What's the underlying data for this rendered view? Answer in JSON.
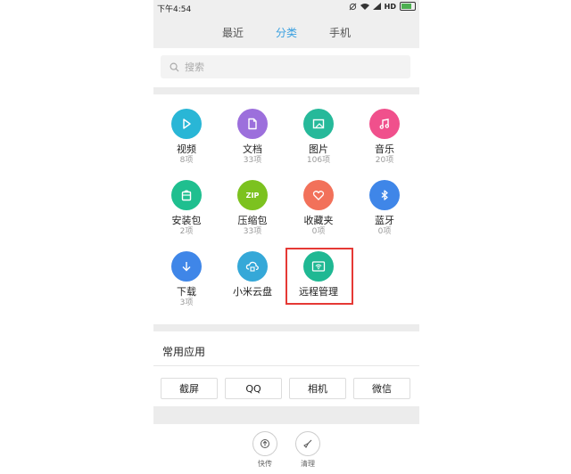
{
  "status_bar": {
    "time": "下午4:54",
    "network": "HD",
    "battery_level": 0.9
  },
  "tabs": [
    {
      "label": "最近"
    },
    {
      "label": "分类",
      "active": true
    },
    {
      "label": "手机"
    }
  ],
  "search": {
    "placeholder": "搜索"
  },
  "categories": [
    {
      "label": "视频",
      "count": "8项",
      "icon": "play-icon",
      "color": "#29b6d6"
    },
    {
      "label": "文档",
      "count": "33项",
      "icon": "document-icon",
      "color": "#9c6fdc"
    },
    {
      "label": "图片",
      "count": "106项",
      "icon": "image-icon",
      "color": "#26b99a"
    },
    {
      "label": "音乐",
      "count": "20项",
      "icon": "music-icon",
      "color": "#f0508c"
    },
    {
      "label": "安装包",
      "count": "2项",
      "icon": "package-icon",
      "color": "#1fbf8f"
    },
    {
      "label": "压缩包",
      "count": "33项",
      "icon": "zip-icon",
      "color": "#7cc21f",
      "icon_text": "ZIP"
    },
    {
      "label": "收藏夹",
      "count": "0项",
      "icon": "heart-icon",
      "color": "#f2715a"
    },
    {
      "label": "蓝牙",
      "count": "0项",
      "icon": "bluetooth-icon",
      "color": "#3f86e8"
    },
    {
      "label": "下载",
      "count": "3项",
      "icon": "download-icon",
      "color": "#3f86e8"
    },
    {
      "label": "小米云盘",
      "count": "",
      "icon": "cloud-icon",
      "color": "#35a8d8"
    },
    {
      "label": "远程管理",
      "count": "",
      "icon": "remote-wifi-icon",
      "color": "#1fb893"
    }
  ],
  "common_apps": {
    "title": "常用应用",
    "items": [
      "截屏",
      "QQ",
      "相机",
      "微信"
    ]
  },
  "bottom_actions": [
    {
      "label": "快传",
      "icon": "quick-send-icon"
    },
    {
      "label": "清理",
      "icon": "broom-icon"
    }
  ]
}
